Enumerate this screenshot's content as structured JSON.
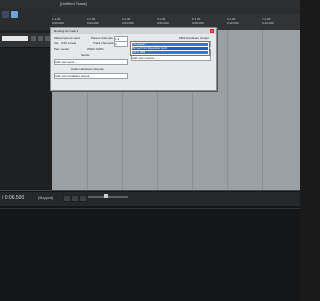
{
  "app": {
    "title": "[Untitled Track]"
  },
  "timeline": {
    "ticks": [
      "1.1.00\n0:00.000",
      "2.1.00\n0:02.000",
      "3.1.00\n0:04.000",
      "4.1.00\n0:06.000",
      "5.1.00\n0:08.000",
      "6.1.00\n0:10.000",
      "7.1.00\n0:12.000"
    ]
  },
  "routing_window": {
    "title": "Routing for track 1",
    "master_send_label": "Master/parent send",
    "parent_channels_label": "Parent channels:",
    "parent_channels_value": "1-2",
    "track_channels_label": "Track channels:",
    "track_channels_value": "2",
    "midi_hw_header": "MIDI Hardware Output",
    "midi_hw_value": "<no output>",
    "vol_label": "Vol:",
    "vol_value": "0.00",
    "pan_label": "Pan:",
    "pan_value": "center",
    "width_label": "Width:",
    "width_value": "100%",
    "linear_label": "Linear",
    "receives_label": "Receives",
    "add_receive_value": "Add new receive...",
    "sends_label": "Sends",
    "add_send_value": "Add new send...",
    "audio_hw_header": "Audio Hardware Outputs",
    "add_hw_output_value": "Add new hardware output...",
    "midi_items": [
      "<no output>",
      "Microsoft GS Wavetable Synth",
      "Out to MIDI"
    ]
  },
  "transport": {
    "time": "/ 0:06.500",
    "status": "[Stopped]"
  }
}
